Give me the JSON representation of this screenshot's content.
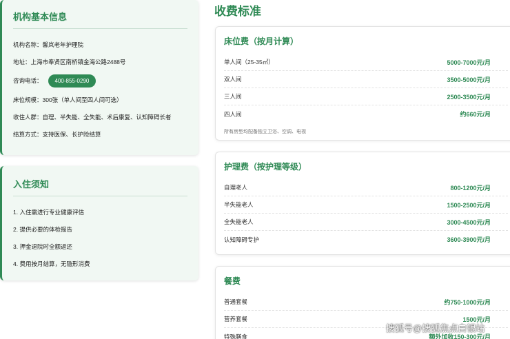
{
  "basic_info": {
    "title": "机构基本信息",
    "name": "机构名称：馨岚老年护理院",
    "address": "地址：上海市奉贤区南桥镇金海公路2488号",
    "phone_label": "咨询电话：",
    "phone": "400-855-0290",
    "beds": "床位规模：300张（单人间至四人间可选）",
    "residents": "收住人群：自理、半失能、全失能、术后康复、认知障碍长者",
    "payment": "结算方式：支持医保、长护险结算"
  },
  "notice": {
    "title": "入住须知",
    "items": [
      "1. 入住需进行专业健康评估",
      "2. 提供必要的体检报告",
      "3. 押金退院时全额返还",
      "4. 费用按月结算，无隐形消费"
    ]
  },
  "fees": {
    "title": "收费标准",
    "bed": {
      "title": "床位费（按月计算）",
      "rows": [
        {
          "name": "单人间（25-35㎡）",
          "price": "5000-7000元/月"
        },
        {
          "name": "双人间",
          "price": "3500-5000元/月"
        },
        {
          "name": "三人间",
          "price": "2500-3500元/月"
        },
        {
          "name": "四人间",
          "price": "约660元/月"
        }
      ],
      "note": "所有房型均配备独立卫浴、空调、电视"
    },
    "care": {
      "title": "护理费（按护理等级）",
      "rows": [
        {
          "name": "自理老人",
          "price": "800-1200元/月"
        },
        {
          "name": "半失能老人",
          "price": "1500-2500元/月"
        },
        {
          "name": "全失能老人",
          "price": "3000-4500元/月"
        },
        {
          "name": "认知障碍专护",
          "price": "3600-3900元/月"
        }
      ]
    },
    "meal": {
      "title": "餐费",
      "rows": [
        {
          "name": "普通套餐",
          "price": "约750-1000元/月"
        },
        {
          "name": "营养套餐",
          "price": "1500元/月"
        },
        {
          "name": "特殊膳食",
          "price": "额外加收150-300元/月"
        }
      ]
    }
  },
  "watermark": "搜狐号@搜狐焦点白银站",
  "colors": {
    "accent": "#2f8a55",
    "card_bg": "#f1f8f3"
  }
}
